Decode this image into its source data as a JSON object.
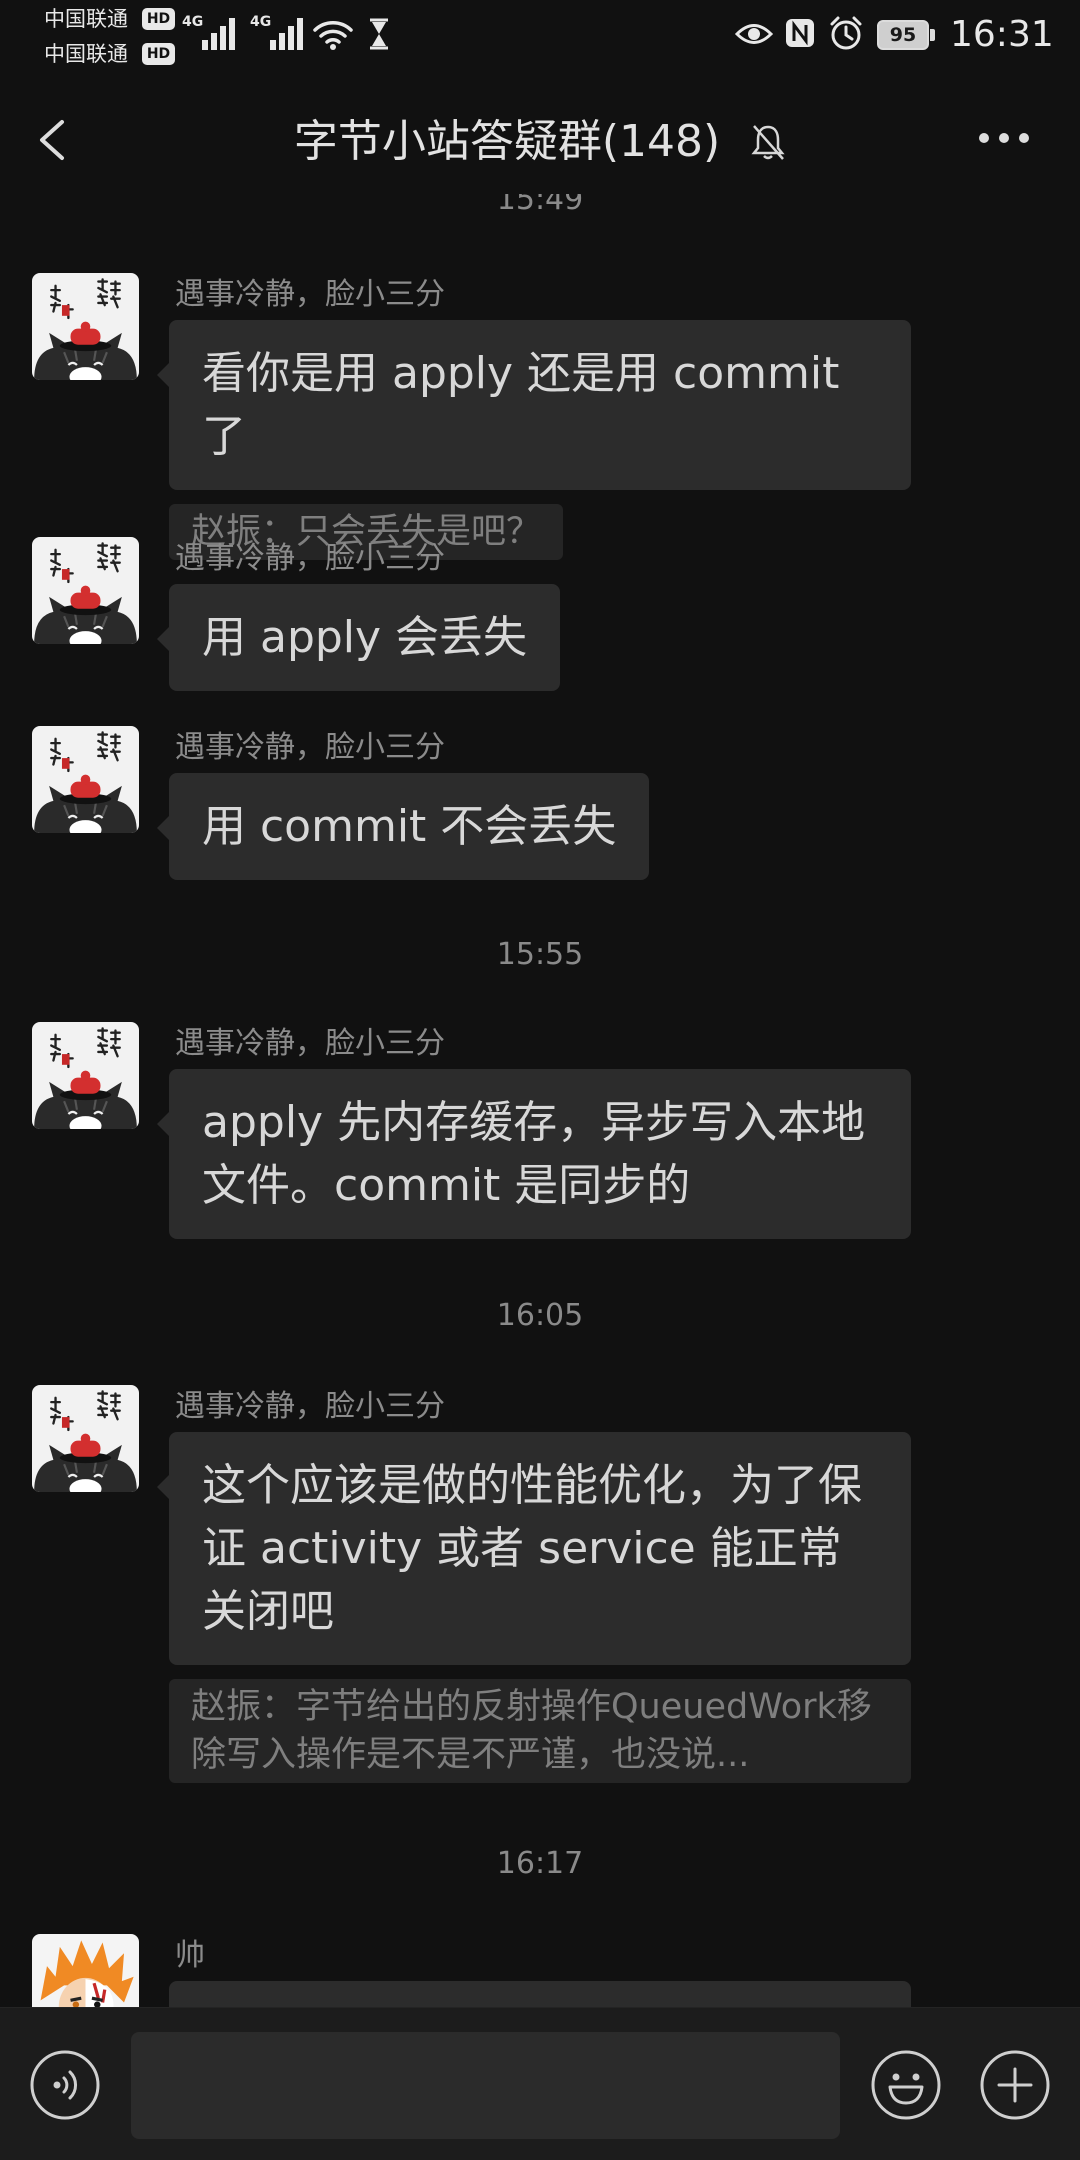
{
  "theme": {
    "background": "#111111",
    "bubble": "#2c2c2c",
    "quote_background": "#252525",
    "muted_text": "#8a8a8a",
    "bottom_bar": "#1c1c1c"
  },
  "status_bar": {
    "carrier_1": "中国联通",
    "carrier_1_badge": "HD",
    "carrier_2": "中国联通",
    "carrier_2_badge": "HD",
    "network_1": "4G",
    "network_2": "4G",
    "battery": "95",
    "time": "16:31"
  },
  "header": {
    "title": "字节小站答疑群(148)"
  },
  "icons": {
    "back": "back-chevron-icon",
    "mute": "bell-off-icon",
    "more": "more-dots-icon",
    "voice": "voice-icon",
    "emoji": "emoji-icon",
    "add": "plus-icon"
  },
  "chat": {
    "items": [
      {
        "time": "15:49"
      },
      {
        "sender": "遇事冷静，脸小三分",
        "text": "看你是用 apply 还是用 commit 了",
        "quote": "赵振：只会丢失是吧？"
      },
      {
        "sender": "遇事冷静，脸小三分",
        "text": "用 apply 会丢失"
      },
      {
        "sender": "遇事冷静，脸小三分",
        "text": "用 commit 不会丢失"
      },
      {
        "time": "15:55"
      },
      {
        "sender": "遇事冷静，脸小三分",
        "text": "apply 先内存缓存，异步写入本地文件。commit 是同步的"
      },
      {
        "time": "16:05"
      },
      {
        "sender": "遇事冷静，脸小三分",
        "text": "这个应该是做的性能优化，为了保证 activity 或者 service 能正常关闭吧",
        "quote": "赵振：字节给出的反射操作QueuedWork移除写入操作是不是不严谨，也没说..."
      },
      {
        "time": "16:17"
      },
      {
        "sender": "帅"
      }
    ]
  }
}
